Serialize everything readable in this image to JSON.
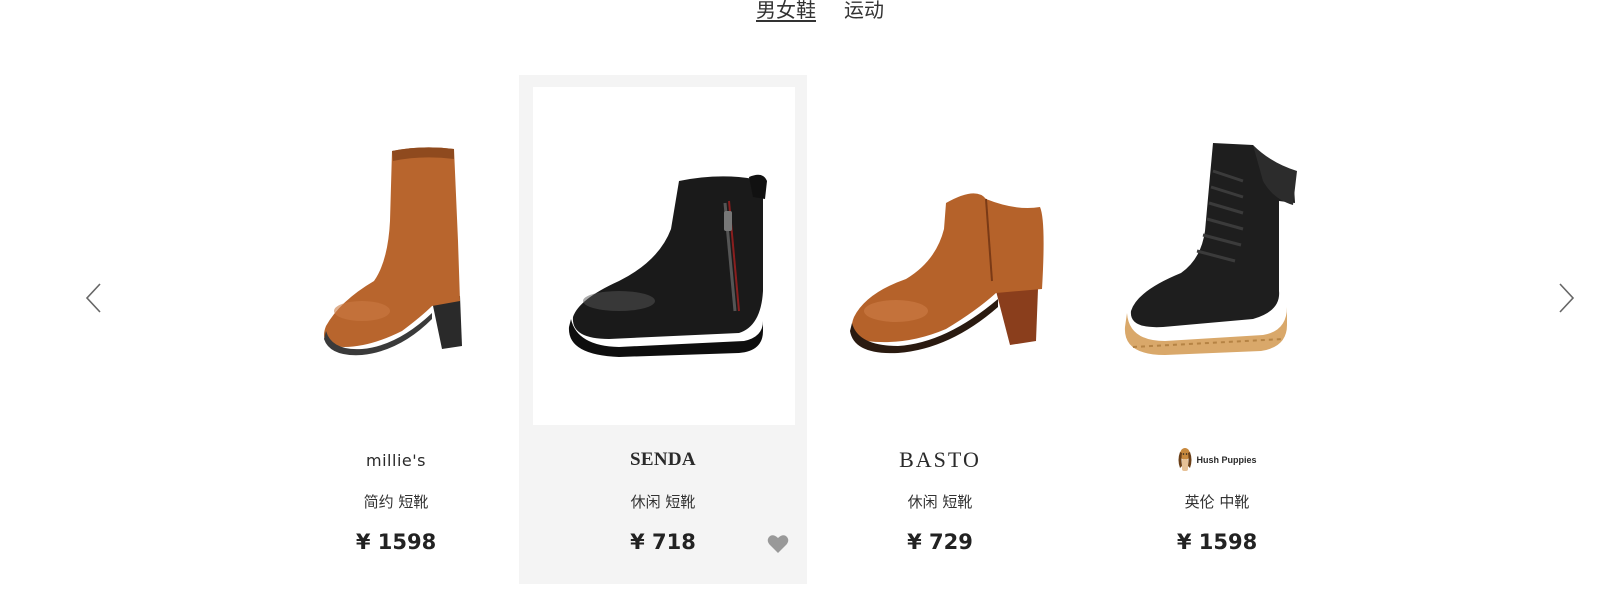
{
  "tabs": [
    {
      "label": "男女鞋",
      "active": true
    },
    {
      "label": "运动",
      "active": false
    }
  ],
  "nav": {
    "prev_icon": "chevron-left-icon",
    "next_icon": "chevron-right-icon"
  },
  "products": [
    {
      "brand": "millie's",
      "description": "简约 短靴",
      "price": "¥ 1598",
      "color": "#b8652d"
    },
    {
      "brand": "SENDA",
      "description": "休闲 短靴",
      "price": "¥ 718",
      "color": "#1a1a1a",
      "hovered": true
    },
    {
      "brand": "BASTO",
      "description": "休闲 短靴",
      "price": "¥ 729",
      "color": "#b5622a"
    },
    {
      "brand": "Hush Puppies",
      "description": "英伦 中靴",
      "price": "¥ 1598",
      "color": "#1e1e1e"
    }
  ],
  "colors": {
    "hover_bg": "#f4f4f4",
    "heart": "#999999"
  }
}
